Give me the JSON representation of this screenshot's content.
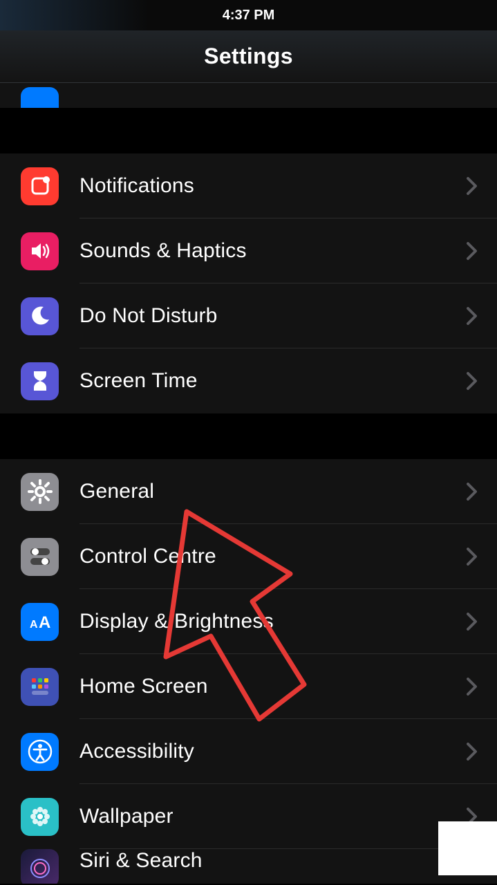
{
  "statusBar": {
    "time": "4:37 PM"
  },
  "header": {
    "title": "Settings"
  },
  "sections": [
    {
      "rows": [
        {
          "id": "notifications",
          "label": "Notifications",
          "iconClass": "bg-notif",
          "iconName": "notification-icon"
        },
        {
          "id": "sounds-haptics",
          "label": "Sounds & Haptics",
          "iconClass": "bg-sound",
          "iconName": "speaker-icon"
        },
        {
          "id": "do-not-disturb",
          "label": "Do Not Disturb",
          "iconClass": "bg-dnd",
          "iconName": "moon-icon"
        },
        {
          "id": "screen-time",
          "label": "Screen Time",
          "iconClass": "bg-screentime",
          "iconName": "hourglass-icon"
        }
      ]
    },
    {
      "rows": [
        {
          "id": "general",
          "label": "General",
          "iconClass": "bg-general",
          "iconName": "gear-icon"
        },
        {
          "id": "control-centre",
          "label": "Control Centre",
          "iconClass": "bg-control",
          "iconName": "toggles-icon"
        },
        {
          "id": "display-brightness",
          "label": "Display & Brightness",
          "iconClass": "bg-display",
          "iconName": "text-size-icon"
        },
        {
          "id": "home-screen",
          "label": "Home Screen",
          "iconClass": "bg-home",
          "iconName": "app-grid-icon"
        },
        {
          "id": "accessibility",
          "label": "Accessibility",
          "iconClass": "bg-access",
          "iconName": "accessibility-icon"
        },
        {
          "id": "wallpaper",
          "label": "Wallpaper",
          "iconClass": "bg-wallpaper",
          "iconName": "flower-icon"
        },
        {
          "id": "siri-search",
          "label": "Siri & Search",
          "iconClass": "bg-siri",
          "iconName": "siri-icon"
        }
      ]
    }
  ]
}
